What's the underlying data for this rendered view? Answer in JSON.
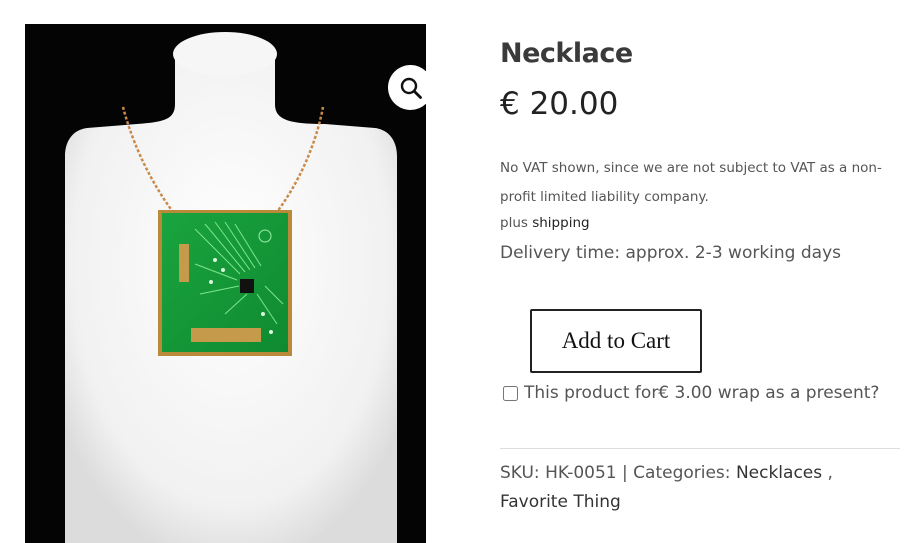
{
  "product": {
    "title": "Necklace",
    "price": "€ 20.00",
    "vat_note": "No VAT shown, since we are not subject to VAT as a non-profit limited liability company.",
    "shipping_prefix": "plus",
    "shipping_link": "shipping",
    "delivery": "Delivery time: approx. 2-3 working days",
    "add_to_cart": "Add to Cart",
    "gift_option": "This product for€ 3.00 wrap as a present?",
    "gift_checked": false,
    "sku_label": "SKU:",
    "sku": "HK-0051",
    "separator": "|",
    "categories_label": "Categories:",
    "categories": [
      "Necklaces",
      "Favorite Thing"
    ],
    "category_separator": ","
  },
  "gallery": {
    "zoom_icon": "magnifier-icon",
    "image_alt": "Necklace with green circuit board pendant on white bust"
  }
}
